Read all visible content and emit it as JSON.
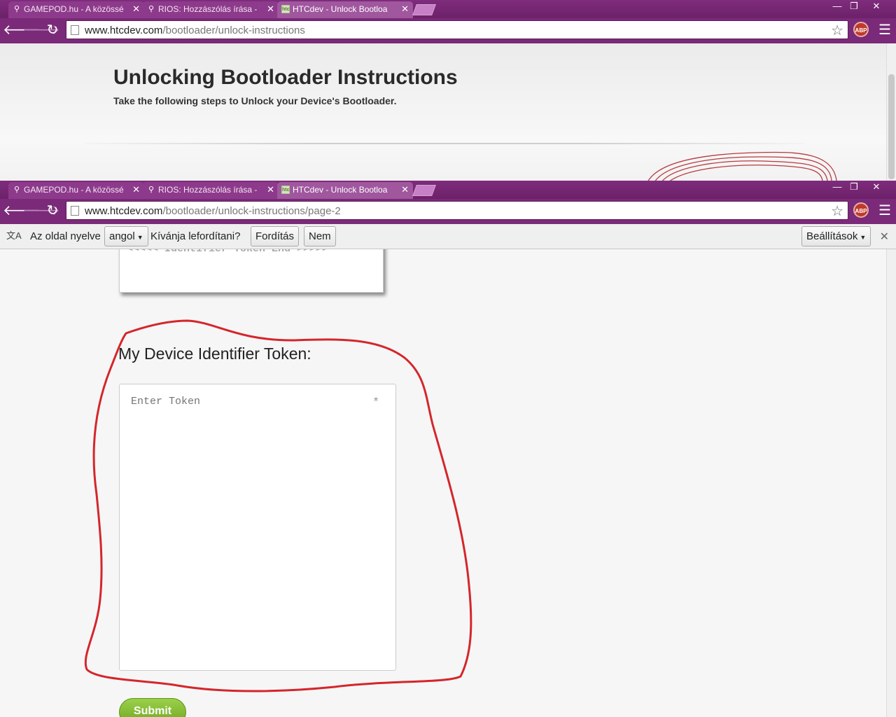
{
  "windows": [
    {
      "tabs": [
        {
          "title": "GAMEPOD.hu - A közössé",
          "icon": "search-icon"
        },
        {
          "title": "RIOS: Hozzászólás írása - T",
          "icon": "search-icon"
        },
        {
          "title": "HTCdev - Unlock Bootloa",
          "icon": "htcdev-favicon",
          "active": true
        }
      ],
      "url_host": "www.htcdev.com",
      "url_path": "/bootloader/unlock-instructions"
    },
    {
      "tabs": [
        {
          "title": "GAMEPOD.hu - A közössé",
          "icon": "search-icon"
        },
        {
          "title": "RIOS: Hozzászólás írása - T",
          "icon": "search-icon"
        },
        {
          "title": "HTCdev - Unlock Bootloa",
          "icon": "htcdev-favicon",
          "active": true
        }
      ],
      "url_host": "www.htcdev.com",
      "url_path": "/bootloader/unlock-instructions/page-2"
    }
  ],
  "extension": {
    "abp_label": "ABP"
  },
  "header": {
    "title": "Unlocking Bootloader Instructions",
    "subtitle": "Take the following steps to Unlock your Device's Bootloader."
  },
  "translate_bar": {
    "language_label": "Az oldal nyelve",
    "language_value": "angol",
    "question": "Kívánja lefordítani?",
    "translate_button": "Fordítás",
    "no_button": "Nem",
    "settings_button": "Beállítások"
  },
  "content": {
    "token_end": "<<<<< Identifier Token End >>>>>",
    "identifier_label": "My Device Identifier Token:",
    "token_placeholder": "Enter Token",
    "required_mark": "*",
    "submit_label": "Submit"
  },
  "colors": {
    "chrome_purple": "#7a2a78",
    "submit_green": "#7cb82f",
    "annotation_red": "#d4262b"
  }
}
